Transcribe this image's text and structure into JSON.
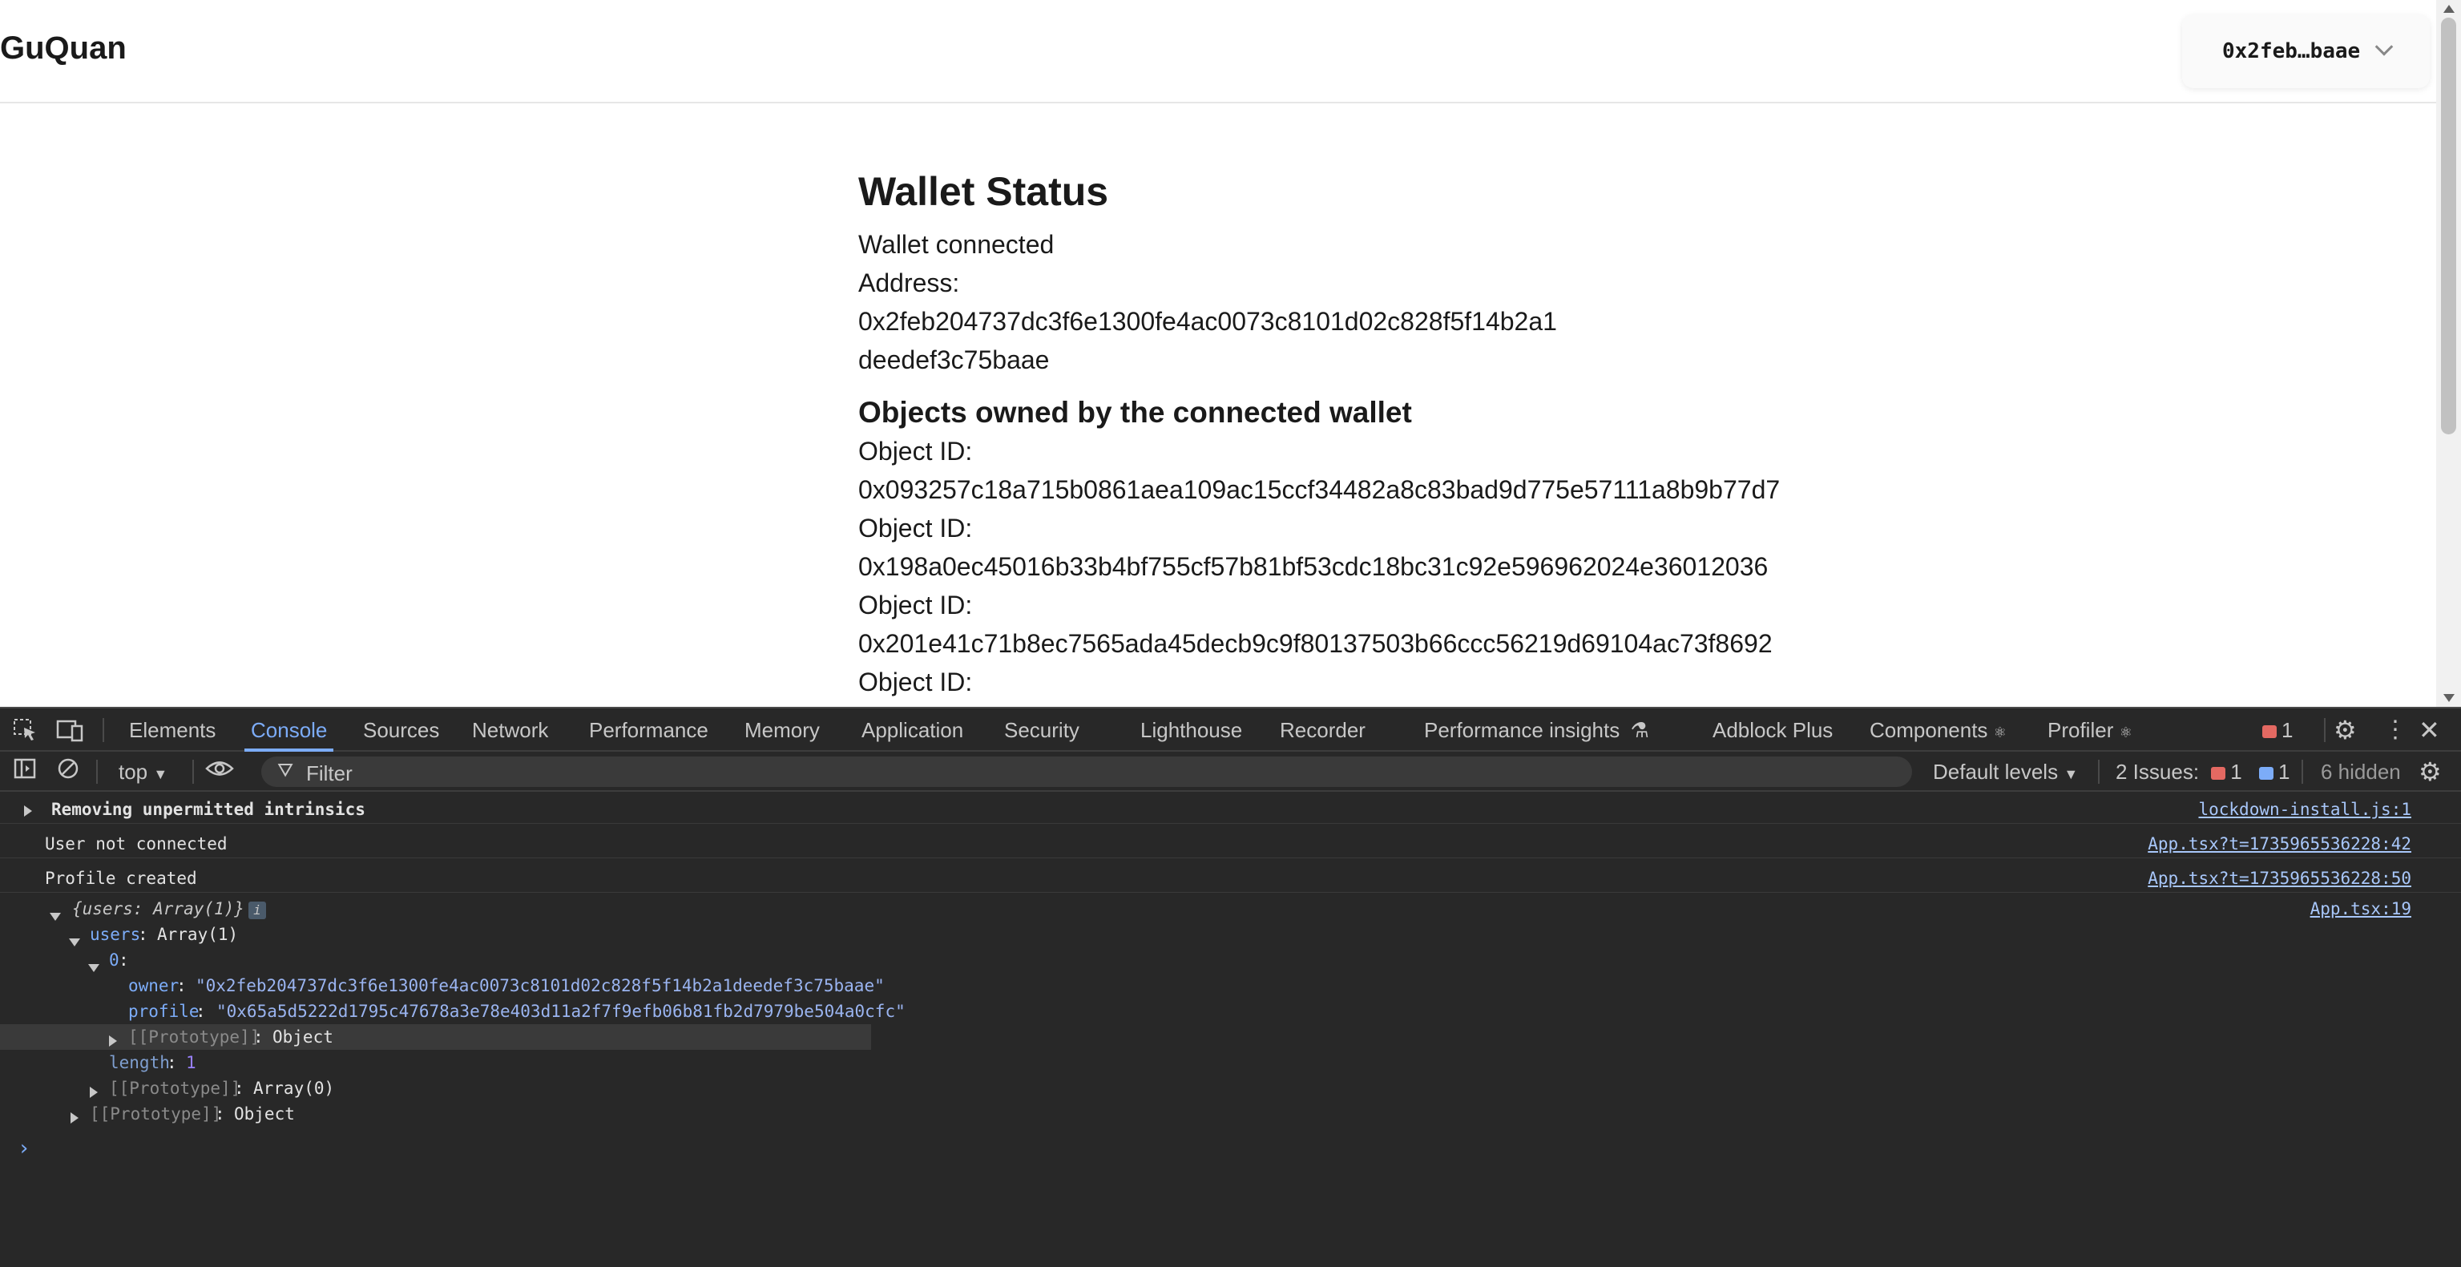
{
  "app": {
    "brand": "GuQuan",
    "wallet_button": {
      "address_short": "0x2feb…baae"
    },
    "main": {
      "title": "Wallet Status",
      "status_text": "Wallet connected",
      "address_label": "Address:",
      "address_line1": "0x2feb204737dc3f6e1300fe4ac0073c8101d02c828f5f14b2a1",
      "address_line2": "deedef3c75baae",
      "objects_heading": "Objects owned by the connected wallet",
      "object_id_label": "Object ID:",
      "objects": [
        "0x093257c18a715b0861aea109ac15ccf34482a8c83bad9d775e57111a8b9b77d7",
        "0x198a0ec45016b33b4bf755cf57b81bf53cdc18bc31c92e596962024e36012036",
        "0x201e41c71b8ec7565ada45decb9c9f80137503b66ccc56219d69104ac73f8692"
      ]
    }
  },
  "devtools": {
    "tabs": [
      "Elements",
      "Console",
      "Sources",
      "Network",
      "Performance",
      "Memory",
      "Application",
      "Security",
      "Lighthouse",
      "Recorder",
      "Performance insights",
      "Adblock Plus",
      "Components",
      "Profiler"
    ],
    "active_tab": "Console",
    "error_count": "1",
    "toolbar": {
      "context": "top",
      "filter_placeholder": "Filter",
      "levels": "Default levels",
      "issues_label": "2 Issues:",
      "issues_errors": "1",
      "issues_info": "1",
      "hidden": "6 hidden"
    },
    "console": {
      "messages": [
        {
          "text": "Removing unpermitted intrinsics",
          "source": "lockdown-install.js:1"
        },
        {
          "text": "User not connected",
          "source": "App.tsx?t=1735965536228:42"
        },
        {
          "text": "Profile created",
          "source": "App.tsx?t=1735965536228:50"
        }
      ],
      "object_log": {
        "summary": "{users: Array(1)}",
        "source": "App.tsx:19",
        "users_key": "users",
        "users_type": "Array(1)",
        "index_key": "0",
        "owner_key": "owner",
        "owner_value": "\"0x2feb204737dc3f6e1300fe4ac0073c8101d02c828f5f14b2a1deedef3c75baae\"",
        "profile_key": "profile",
        "profile_value": "\"0x65a5d5222d1795c47678a3e78e403d11a2f7f9efb06b81fb2d7979be504a0cfc\"",
        "proto_key": "[[Prototype]]",
        "proto_object": "Object",
        "length_key": "length",
        "length_value": "1",
        "proto_array": "Array(0)"
      }
    }
  }
}
